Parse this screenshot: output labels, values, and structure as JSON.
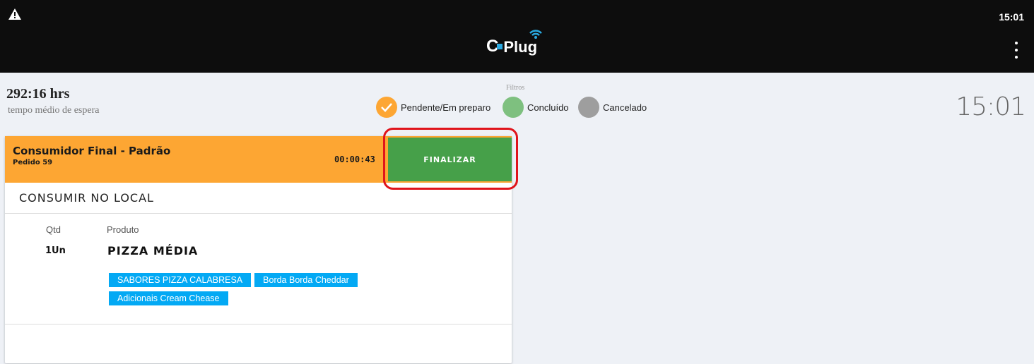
{
  "statusbar": {
    "time": "15:01",
    "warning_icon": "warning-icon"
  },
  "app": {
    "logo_text": "Plug",
    "logo_letter": "C",
    "menu_icon": "more-vert-icon"
  },
  "info": {
    "avg_wait": "292:16 hrs",
    "avg_wait_label": "tempo médio de espera",
    "filters_label": "Filtros",
    "clock": "15:01",
    "filters": [
      {
        "label": "Pendente/Em preparo",
        "color": "#fda633",
        "checked": true
      },
      {
        "label": "Concluído",
        "color": "#7ec07f",
        "checked": false
      },
      {
        "label": "Cancelado",
        "color": "#9e9e9e",
        "checked": false
      }
    ]
  },
  "order": {
    "customer": "Consumidor Final - Padrão",
    "order_number": "Pedido 59",
    "timer": "00:00:43",
    "finalize_label": "FINALIZAR",
    "mode": "CONSUMIR NO LOCAL",
    "col_qty": "Qtd",
    "col_product": "Produto",
    "items": [
      {
        "qty": "1Un",
        "product": "PIZZA MÉDIA",
        "tags": [
          "SABORES PIZZA CALABRESA",
          "Borda Borda Cheddar",
          "Adicionais Cream Chease"
        ]
      }
    ]
  }
}
